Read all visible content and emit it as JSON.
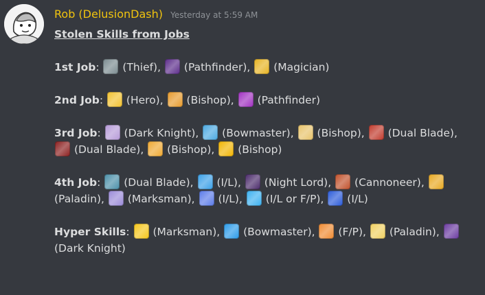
{
  "message": {
    "author": "Rob (DelusionDash)",
    "timestamp": "Yesterday at 5:59 AM",
    "title": "Stolen Skills from Jobs",
    "sections": [
      {
        "label": "1st Job",
        "items": [
          {
            "icon": "thief-skill-icon",
            "color": "#7a8a8f",
            "label": "(Thief)"
          },
          {
            "icon": "pathfinder-skill-icon",
            "color": "#5b2b8a",
            "label": "(Pathfinder)"
          },
          {
            "icon": "magician-skill-icon",
            "color": "#e7b321",
            "label": "(Magician)"
          }
        ]
      },
      {
        "label": "2nd Job",
        "items": [
          {
            "icon": "hero-skill-icon",
            "color": "#f2c12e",
            "label": "(Hero)"
          },
          {
            "icon": "bishop-skill-icon",
            "color": "#e79a2b",
            "label": "(Bishop)"
          },
          {
            "icon": "pathfinder-skill-icon",
            "color": "#a030c0",
            "label": "(Pathfinder)"
          }
        ]
      },
      {
        "label": "3rd Job",
        "items": [
          {
            "icon": "dark-knight-skill-icon",
            "color": "#b69ad8",
            "label": "(Dark Knight)"
          },
          {
            "icon": "bowmaster-skill-icon",
            "color": "#4aa8e0",
            "label": "(Bowmaster)"
          },
          {
            "icon": "bishop-skill-icon",
            "color": "#e8c36a",
            "label": "(Bishop)"
          },
          {
            "icon": "dual-blade-skill-icon",
            "color": "#c0392b",
            "label": "(Dual Blade)"
          },
          {
            "icon": "dual-blade-skill-icon",
            "color": "#8b1e1e",
            "label": "(Dual Blade)"
          },
          {
            "icon": "bishop-skill-icon",
            "color": "#f0a830",
            "label": "(Bishop)"
          },
          {
            "icon": "bishop-skill-icon",
            "color": "#f2b400",
            "label": "(Bishop)"
          }
        ]
      },
      {
        "label": "4th Job",
        "items": [
          {
            "icon": "dual-blade-skill-icon",
            "color": "#4a8fa8",
            "label": "(Dual Blade)"
          },
          {
            "icon": "ice-lightning-skill-icon",
            "color": "#3aa0e8",
            "label": "(I/L)"
          },
          {
            "icon": "night-lord-skill-icon",
            "color": "#4a2a6a",
            "label": "(Night Lord)"
          },
          {
            "icon": "cannoneer-skill-icon",
            "color": "#c0502a",
            "label": "(Cannoneer)"
          },
          {
            "icon": "paladin-skill-icon",
            "color": "#e8a820",
            "label": "(Paladin)"
          },
          {
            "icon": "marksman-skill-icon",
            "color": "#9a8ad8",
            "label": "(Marksman)"
          },
          {
            "icon": "ice-lightning-skill-icon",
            "color": "#5a7ae8",
            "label": "(I/L)"
          },
          {
            "icon": "ice-lightning-skill-icon",
            "color": "#3ab0f0",
            "label": "(I/L or F/P)"
          },
          {
            "icon": "ice-lightning-skill-icon",
            "color": "#2a5ad8",
            "label": "(I/L)"
          }
        ]
      },
      {
        "label": "Hyper Skills",
        "items": [
          {
            "icon": "marksman-skill-icon",
            "color": "#f5c518",
            "label": "(Marksman)"
          },
          {
            "icon": "bowmaster-skill-icon",
            "color": "#2a9ae8",
            "label": "(Bowmaster)"
          },
          {
            "icon": "fire-poison-skill-icon",
            "color": "#f08a30",
            "label": "(F/P)"
          },
          {
            "icon": "paladin-skill-icon",
            "color": "#f0d060",
            "label": "(Paladin)"
          },
          {
            "icon": "dark-knight-skill-icon",
            "color": "#6a3aa0",
            "label": "(Dark Knight)"
          }
        ]
      }
    ]
  }
}
